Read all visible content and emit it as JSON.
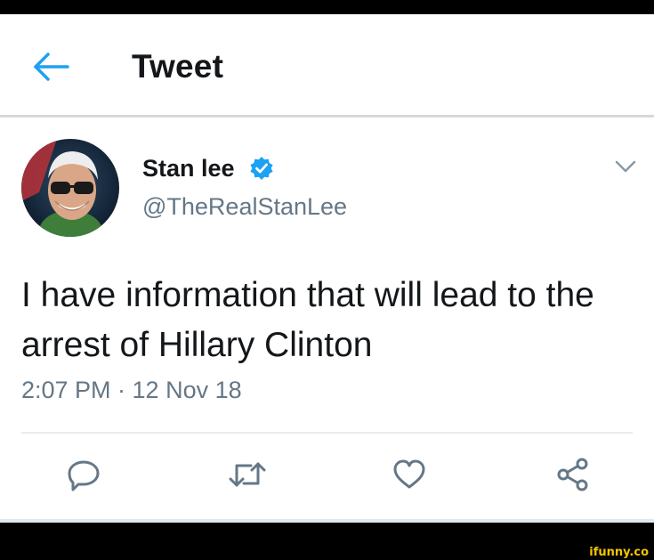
{
  "header": {
    "title": "Tweet",
    "back_icon": "arrow-left-icon"
  },
  "author": {
    "display_name": "Stan lee",
    "handle": "@TheRealStanLee",
    "verified_icon": "verified-badge-icon"
  },
  "tweet": {
    "text": "I have information that will lead to the arrest of Hillary Clinton",
    "timestamp": "2:07 PM · 12 Nov 18"
  },
  "actions": [
    {
      "name": "reply",
      "icon": "reply-icon"
    },
    {
      "name": "retweet",
      "icon": "retweet-icon"
    },
    {
      "name": "like",
      "icon": "heart-icon"
    },
    {
      "name": "share",
      "icon": "share-icon"
    }
  ],
  "colors": {
    "accent": "#1da1f2",
    "secondary_text": "#657786",
    "primary_text": "#14171a"
  },
  "watermark": "ifunny.co"
}
